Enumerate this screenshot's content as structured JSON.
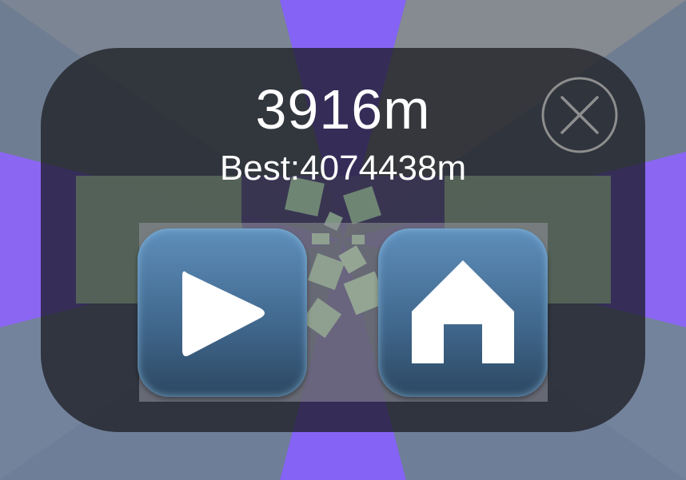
{
  "result": {
    "distance": "3916m",
    "best": "Best:4074438m"
  },
  "controls": {
    "close_icon": "close-x-icon",
    "play_icon": "play-triangle-icon",
    "home_icon": "house-icon"
  },
  "colors": {
    "accent_purple": "#8463f5",
    "background_slate": "#6f7d92",
    "button_blue": "#4a76a0"
  }
}
